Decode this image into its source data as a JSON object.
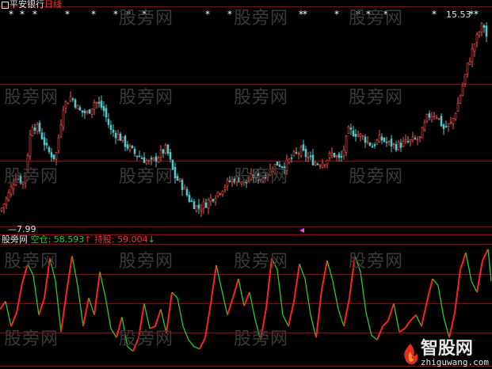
{
  "watermark": "股旁网",
  "main_panel": {
    "stock_name": "平安银行",
    "period": "日线",
    "high_label": "15.53",
    "low_label": "7.99",
    "star_marker": "*"
  },
  "sub_panel": {
    "indicator_name": "股旁网",
    "short_label": "空仓:",
    "short_value": "58.593",
    "short_arrow": "↑",
    "hold_label": "持股:",
    "hold_value": "59.004",
    "hold_arrow": "↓"
  },
  "logo": {
    "name": "智股网",
    "url": "zhiguwang.com"
  },
  "colors": {
    "background": "#000000",
    "frame": "#a00000",
    "candle_up": "#ff5050",
    "candle_down": "#50c8c8",
    "line_up": "#ff2020",
    "line_down": "#20d020",
    "label_white": "#e0e0e0",
    "label_green": "#20d020",
    "label_red": "#ff3030",
    "marker": "#ff40ff",
    "watermark": "#3a3a3a"
  },
  "chart_data": [
    {
      "type": "candlestick",
      "title": "平安银行 日线",
      "annotations": [
        "15.53",
        "7.99"
      ],
      "close_x": [
        0,
        10,
        20,
        30,
        40,
        50,
        60,
        70,
        80,
        90,
        100,
        110,
        120,
        130,
        140,
        150,
        160,
        170,
        180,
        190,
        200,
        210,
        220,
        230,
        240,
        250,
        260,
        270,
        280,
        290,
        300,
        310,
        320,
        330,
        340,
        350,
        360,
        370,
        380,
        390,
        400,
        410,
        420,
        430,
        440,
        450,
        460,
        470,
        480,
        490,
        500,
        510,
        520,
        530,
        540,
        550,
        560,
        570,
        580,
        590,
        600,
        610,
        620
      ],
      "close": [
        7.99,
        8.6,
        9.4,
        9.1,
        11.5,
        11.2,
        10.4,
        10.1,
        12.2,
        12.6,
        12.0,
        11.9,
        12.4,
        12.1,
        11.2,
        11.0,
        10.6,
        10.3,
        10.1,
        9.9,
        10.2,
        10.5,
        9.4,
        9.0,
        8.4,
        8.1,
        8.3,
        8.6,
        8.9,
        9.2,
        9.3,
        9.1,
        9.4,
        9.3,
        9.6,
        9.9,
        9.8,
        10.2,
        10.4,
        10.1,
        9.9,
        10.0,
        10.3,
        10.0,
        11.2,
        11.1,
        10.9,
        10.6,
        10.9,
        10.7,
        10.6,
        10.7,
        10.8,
        10.9,
        11.8,
        11.9,
        11.3,
        11.5,
        12.5,
        13.8,
        14.8,
        15.53,
        14.2
      ],
      "ylim": [
        7.5,
        16.0
      ]
    },
    {
      "type": "line",
      "series": [
        {
          "name": "空仓",
          "color": "#20d020"
        },
        {
          "name": "持股",
          "color": "#ff2020"
        }
      ],
      "x": [
        0,
        7,
        14,
        21,
        28,
        35,
        42,
        49,
        56,
        63,
        70,
        77,
        84,
        91,
        98,
        105,
        112,
        119,
        126,
        133,
        140,
        147,
        154,
        161,
        168,
        175,
        182,
        189,
        196,
        203,
        210,
        217,
        224,
        231,
        238,
        245,
        252,
        259,
        266,
        273,
        280,
        287,
        294,
        301,
        308,
        315,
        322,
        329,
        336,
        343,
        350,
        357,
        364,
        371,
        378,
        385,
        392,
        399,
        406,
        413,
        420,
        427,
        434,
        441,
        448,
        455,
        462,
        469,
        476,
        483,
        490,
        497,
        504,
        511,
        518,
        525,
        532,
        539,
        546,
        553,
        560,
        567,
        574,
        581,
        588,
        595,
        602,
        609,
        616,
        620
      ],
      "values": [
        45,
        52,
        30,
        42,
        68,
        85,
        75,
        40,
        55,
        90,
        70,
        25,
        60,
        92,
        66,
        30,
        55,
        40,
        78,
        56,
        28,
        20,
        38,
        12,
        8,
        20,
        50,
        28,
        30,
        45,
        24,
        60,
        55,
        30,
        18,
        12,
        10,
        20,
        50,
        84,
        62,
        40,
        55,
        72,
        48,
        60,
        36,
        18,
        46,
        90,
        80,
        40,
        30,
        52,
        85,
        72,
        40,
        20,
        62,
        88,
        70,
        45,
        30,
        55,
        92,
        78,
        42,
        22,
        18,
        30,
        35,
        50,
        25,
        28,
        35,
        40,
        30,
        52,
        72,
        66,
        38,
        20,
        42,
        80,
        95,
        70,
        60,
        88,
        98,
        70
      ],
      "ylim": [
        0,
        100
      ]
    }
  ]
}
